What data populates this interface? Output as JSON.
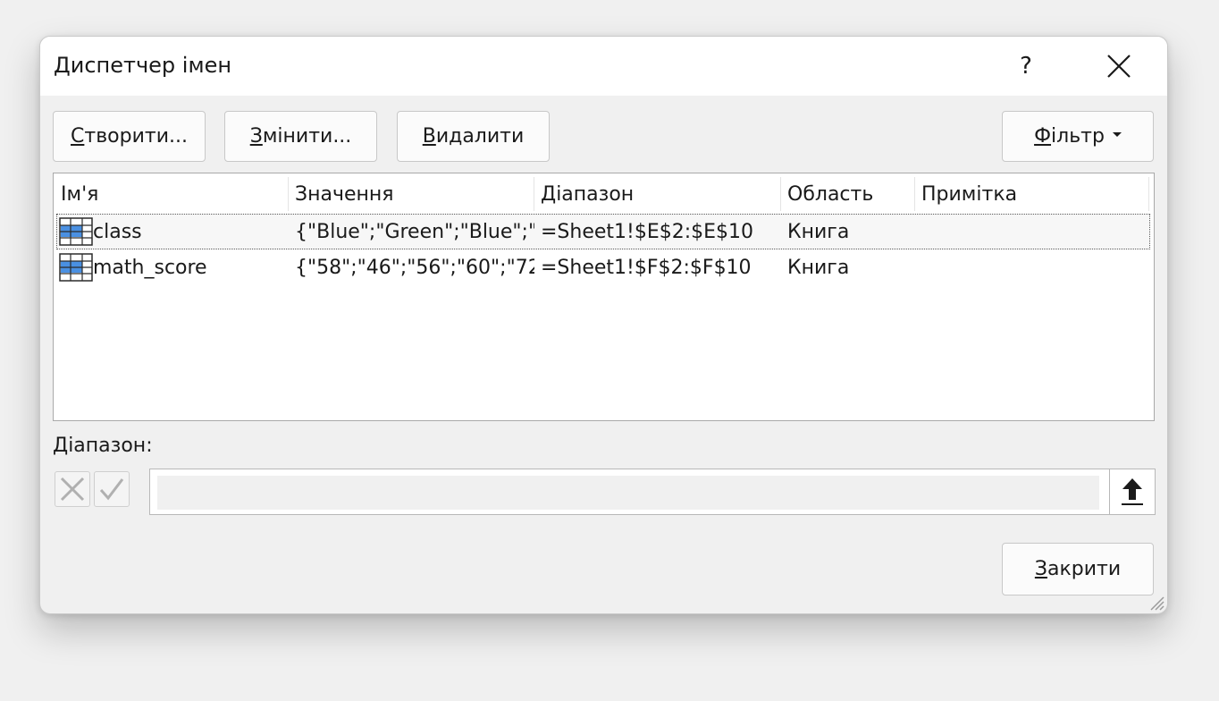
{
  "dialog": {
    "title": "Диспетчер імен",
    "help_label": "?"
  },
  "toolbar": {
    "new": {
      "accel": "С",
      "rest": "творити..."
    },
    "edit": {
      "accel": "З",
      "rest": "мінити..."
    },
    "delete": {
      "accel": "В",
      "rest": "идалити"
    },
    "filter": {
      "accel": "Ф",
      "rest": "ільтр"
    }
  },
  "list": {
    "columns": [
      "Ім'я",
      "Значення",
      "Діапазон",
      "Область",
      "Примітка"
    ],
    "rows": [
      {
        "name": "class",
        "value": "{\"Blue\";\"Green\";\"Blue\";\"...",
        "range": "=Sheet1!$E$2:$E$10",
        "scope": "Книга",
        "comment": "",
        "selected": true
      },
      {
        "name": "math_score",
        "value": "{\"58\";\"46\";\"56\";\"60\";\"72...",
        "range": "=Sheet1!$F$2:$F$10",
        "scope": "Книга",
        "comment": "",
        "selected": false
      }
    ]
  },
  "range_editor": {
    "label": "Діапазон:",
    "value": ""
  },
  "footer": {
    "close": {
      "accel": "З",
      "rest": "акрити"
    }
  },
  "icons": {
    "close": "close-icon",
    "cancel": "cancel-x-icon",
    "confirm": "check-icon",
    "collapse": "collapse-arrow-icon",
    "name_row": "table-range-icon"
  },
  "colors": {
    "icon_blue": "#4a90e2"
  }
}
